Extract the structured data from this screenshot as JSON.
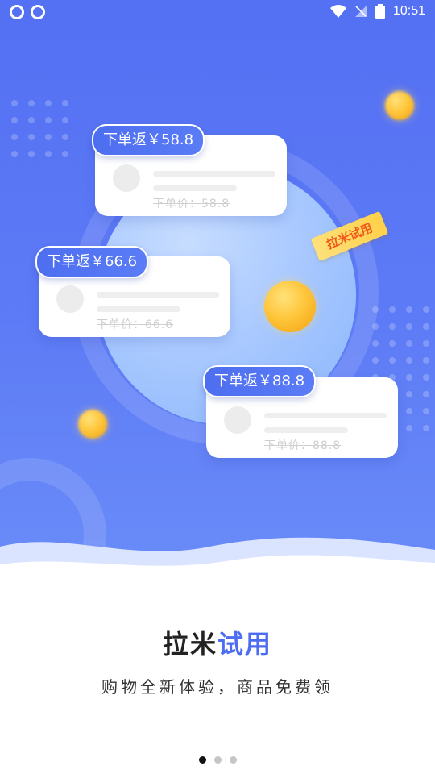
{
  "status_bar": {
    "time": "10:51"
  },
  "ribbon": {
    "label": "拉米试用"
  },
  "cards": [
    {
      "badge": "下单返￥58.8",
      "price": "下单价：58.8"
    },
    {
      "badge": "下单返￥66.6",
      "price": "下单价：66.6"
    },
    {
      "badge": "下单返￥88.8",
      "price": "下单价：88.8"
    }
  ],
  "title": {
    "main": "拉米",
    "accent": "试用"
  },
  "subtitle": "购物全新体验，商品免费领",
  "pager": {
    "count": 3,
    "active_index": 0
  },
  "colors": {
    "hero_blue": "#5470f3",
    "accent": "#4c6df0",
    "coin_gold": "#ffc63c",
    "ribbon_text": "#f05a1e"
  }
}
